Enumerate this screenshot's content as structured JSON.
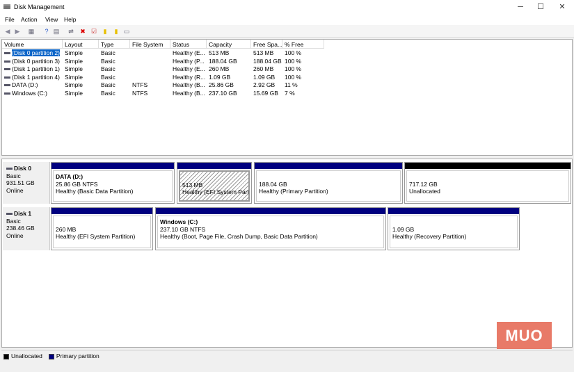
{
  "window": {
    "title": "Disk Management"
  },
  "menu": [
    "File",
    "Action",
    "View",
    "Help"
  ],
  "toolbar": [
    "back-icon",
    "forward-icon",
    "console-tree-icon",
    "help-icon",
    "properties-icon",
    "connect-icon",
    "delete-icon",
    "check-icon",
    "new-volume-icon",
    "search-icon",
    "view-icon"
  ],
  "table": {
    "columns": [
      "Volume",
      "Layout",
      "Type",
      "File System",
      "Status",
      "Capacity",
      "Free Spa...",
      "% Free"
    ],
    "rows": [
      [
        "(Disk 0 partition 2)",
        "Simple",
        "Basic",
        "",
        "Healthy (E...",
        "513 MB",
        "513 MB",
        "100 %"
      ],
      [
        "(Disk 0 partition 3)",
        "Simple",
        "Basic",
        "",
        "Healthy (P...",
        "188.04 GB",
        "188.04 GB",
        "100 %"
      ],
      [
        "(Disk 1 partition 1)",
        "Simple",
        "Basic",
        "",
        "Healthy (E...",
        "260 MB",
        "260 MB",
        "100 %"
      ],
      [
        "(Disk 1 partition 4)",
        "Simple",
        "Basic",
        "",
        "Healthy (R...",
        "1.09 GB",
        "1.09 GB",
        "100 %"
      ],
      [
        "DATA (D:)",
        "Simple",
        "Basic",
        "NTFS",
        "Healthy (B...",
        "25.86 GB",
        "2.92 GB",
        "11 %"
      ],
      [
        "Windows (C:)",
        "Simple",
        "Basic",
        "NTFS",
        "Healthy (B...",
        "237.10 GB",
        "15.69 GB",
        "7 %"
      ]
    ]
  },
  "disks": [
    {
      "name": "Disk 0",
      "type": "Basic",
      "size": "931.51 GB",
      "status": "Online",
      "partitions": [
        {
          "title": "DATA  (D:)",
          "size": "25.86 GB NTFS",
          "status": "Healthy (Basic Data Partition)",
          "kind": "primary"
        },
        {
          "title": "",
          "size": "513 MB",
          "status": "Healthy (EFI System Partition)",
          "kind": "primary",
          "selected": true
        },
        {
          "title": "",
          "size": "188.04 GB",
          "status": "Healthy (Primary Partition)",
          "kind": "primary"
        },
        {
          "title": "",
          "size": "717.12 GB",
          "status": "Unallocated",
          "kind": "unallocated"
        }
      ]
    },
    {
      "name": "Disk 1",
      "type": "Basic",
      "size": "238.46 GB",
      "status": "Online",
      "partitions": [
        {
          "title": "",
          "size": "260 MB",
          "status": "Healthy (EFI System Partition)",
          "kind": "primary"
        },
        {
          "title": "Windows  (C:)",
          "size": "237.10 GB NTFS",
          "status": "Healthy (Boot, Page File, Crash Dump, Basic Data Partition)",
          "kind": "primary"
        },
        {
          "title": "",
          "size": "1.09 GB",
          "status": "Healthy (Recovery Partition)",
          "kind": "primary"
        }
      ]
    }
  ],
  "legend": [
    {
      "label": "Unallocated",
      "color": "#000000"
    },
    {
      "label": "Primary partition",
      "color": "#000080"
    }
  ],
  "watermark": "MUO"
}
